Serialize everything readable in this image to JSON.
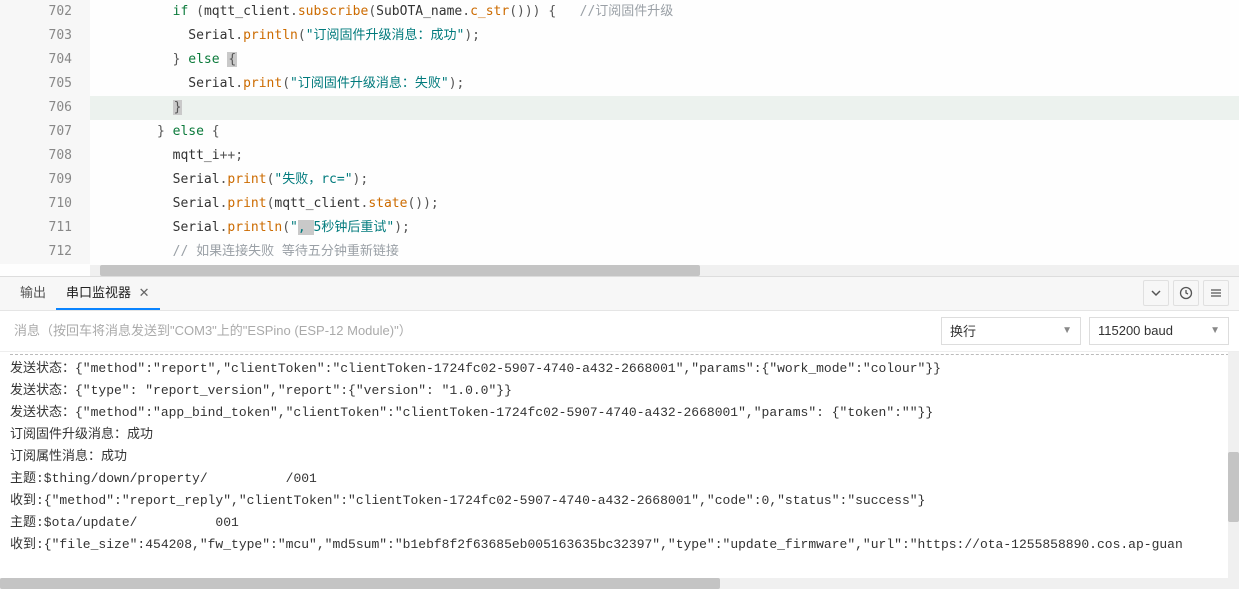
{
  "code": {
    "lines": [
      {
        "num": 702,
        "indent": "        ",
        "tokens": [
          {
            "t": "kw",
            "v": "if"
          },
          {
            "t": "punct",
            "v": " ("
          },
          {
            "t": "ident",
            "v": "mqtt_client"
          },
          {
            "t": "punct",
            "v": "."
          },
          {
            "t": "func",
            "v": "subscribe"
          },
          {
            "t": "punct",
            "v": "("
          },
          {
            "t": "ident",
            "v": "SubOTA_name"
          },
          {
            "t": "punct",
            "v": "."
          },
          {
            "t": "func",
            "v": "c_str"
          },
          {
            "t": "punct",
            "v": "())) {   "
          },
          {
            "t": "cmt",
            "v": "//订阅固件升级"
          }
        ]
      },
      {
        "num": 703,
        "indent": "          ",
        "tokens": [
          {
            "t": "ident",
            "v": "Serial"
          },
          {
            "t": "punct",
            "v": "."
          },
          {
            "t": "func",
            "v": "println"
          },
          {
            "t": "punct",
            "v": "("
          },
          {
            "t": "str",
            "v": "\"订阅固件升级消息：成功\""
          },
          {
            "t": "punct",
            "v": ");"
          }
        ]
      },
      {
        "num": 704,
        "indent": "        ",
        "tokens": [
          {
            "t": "punct",
            "v": "} "
          },
          {
            "t": "kw",
            "v": "else"
          },
          {
            "t": "punct",
            "v": " "
          },
          {
            "t": "bracket",
            "v": "{"
          }
        ]
      },
      {
        "num": 705,
        "indent": "          ",
        "tokens": [
          {
            "t": "ident",
            "v": "Serial"
          },
          {
            "t": "punct",
            "v": "."
          },
          {
            "t": "func",
            "v": "print"
          },
          {
            "t": "punct",
            "v": "("
          },
          {
            "t": "str",
            "v": "\"订阅固件升级消息：失败\""
          },
          {
            "t": "punct",
            "v": ");"
          }
        ]
      },
      {
        "num": 706,
        "indent": "        ",
        "highlight": true,
        "tokens": [
          {
            "t": "bracket",
            "v": "}"
          }
        ]
      },
      {
        "num": 707,
        "indent": "      ",
        "tokens": [
          {
            "t": "punct",
            "v": "} "
          },
          {
            "t": "kw",
            "v": "else"
          },
          {
            "t": "punct",
            "v": " {"
          }
        ]
      },
      {
        "num": 708,
        "indent": "        ",
        "tokens": [
          {
            "t": "ident",
            "v": "mqtt_i"
          },
          {
            "t": "punct",
            "v": "++;"
          }
        ]
      },
      {
        "num": 709,
        "indent": "        ",
        "tokens": [
          {
            "t": "ident",
            "v": "Serial"
          },
          {
            "t": "punct",
            "v": "."
          },
          {
            "t": "func",
            "v": "print"
          },
          {
            "t": "punct",
            "v": "("
          },
          {
            "t": "str",
            "v": "\"失败，rc=\""
          },
          {
            "t": "punct",
            "v": ");"
          }
        ]
      },
      {
        "num": 710,
        "indent": "        ",
        "tokens": [
          {
            "t": "ident",
            "v": "Serial"
          },
          {
            "t": "punct",
            "v": "."
          },
          {
            "t": "func",
            "v": "print"
          },
          {
            "t": "punct",
            "v": "("
          },
          {
            "t": "ident",
            "v": "mqtt_client"
          },
          {
            "t": "punct",
            "v": "."
          },
          {
            "t": "func",
            "v": "state"
          },
          {
            "t": "punct",
            "v": "());"
          }
        ]
      },
      {
        "num": 711,
        "indent": "        ",
        "tokens": [
          {
            "t": "ident",
            "v": "Serial"
          },
          {
            "t": "punct",
            "v": "."
          },
          {
            "t": "func",
            "v": "println"
          },
          {
            "t": "punct",
            "v": "("
          },
          {
            "t": "str",
            "v": "\""
          },
          {
            "t": "cursor",
            "v": ", "
          },
          {
            "t": "str",
            "v": "5秒钟后重试\""
          },
          {
            "t": "punct",
            "v": ");"
          }
        ]
      },
      {
        "num": 712,
        "indent": "        ",
        "tokens": [
          {
            "t": "cmt",
            "v": "// 如果连接失败 等待五分钟重新链接"
          }
        ]
      }
    ]
  },
  "panel": {
    "tabs": {
      "output": "输出",
      "serial": "串口监视器"
    },
    "input_placeholder": "消息（按回车将消息发送到\"COM3\"上的\"ESPino (ESP-12 Module)\"）",
    "wrap_label": "换行",
    "baud_label": "115200 baud"
  },
  "console": {
    "lines": [
      "发送状态：{\"method\":\"report\",\"clientToken\":\"clientToken-1724fc02-5907-4740-a432-2668001\",\"params\":{\"work_mode\":\"colour\"}}",
      "发送状态：{\"type\": \"report_version\",\"report\":{\"version\": \"1.0.0\"}}",
      "发送状态：{\"method\":\"app_bind_token\",\"clientToken\":\"clientToken-1724fc02-5907-4740-a432-2668001\",\"params\": {\"token\":\"\"}}",
      "订阅固件升级消息：成功",
      "订阅属性消息：成功",
      "主题:$thing/down/property/          /001",
      "收到:{\"method\":\"report_reply\",\"clientToken\":\"clientToken-1724fc02-5907-4740-a432-2668001\",\"code\":0,\"status\":\"success\"}",
      "主题:$ota/update/          001",
      "收到:{\"file_size\":454208,\"fw_type\":\"mcu\",\"md5sum\":\"b1ebf8f2f63685eb005163635bc32397\",\"type\":\"update_firmware\",\"url\":\"https://ota-1255858890.cos.ap-guan"
    ]
  }
}
